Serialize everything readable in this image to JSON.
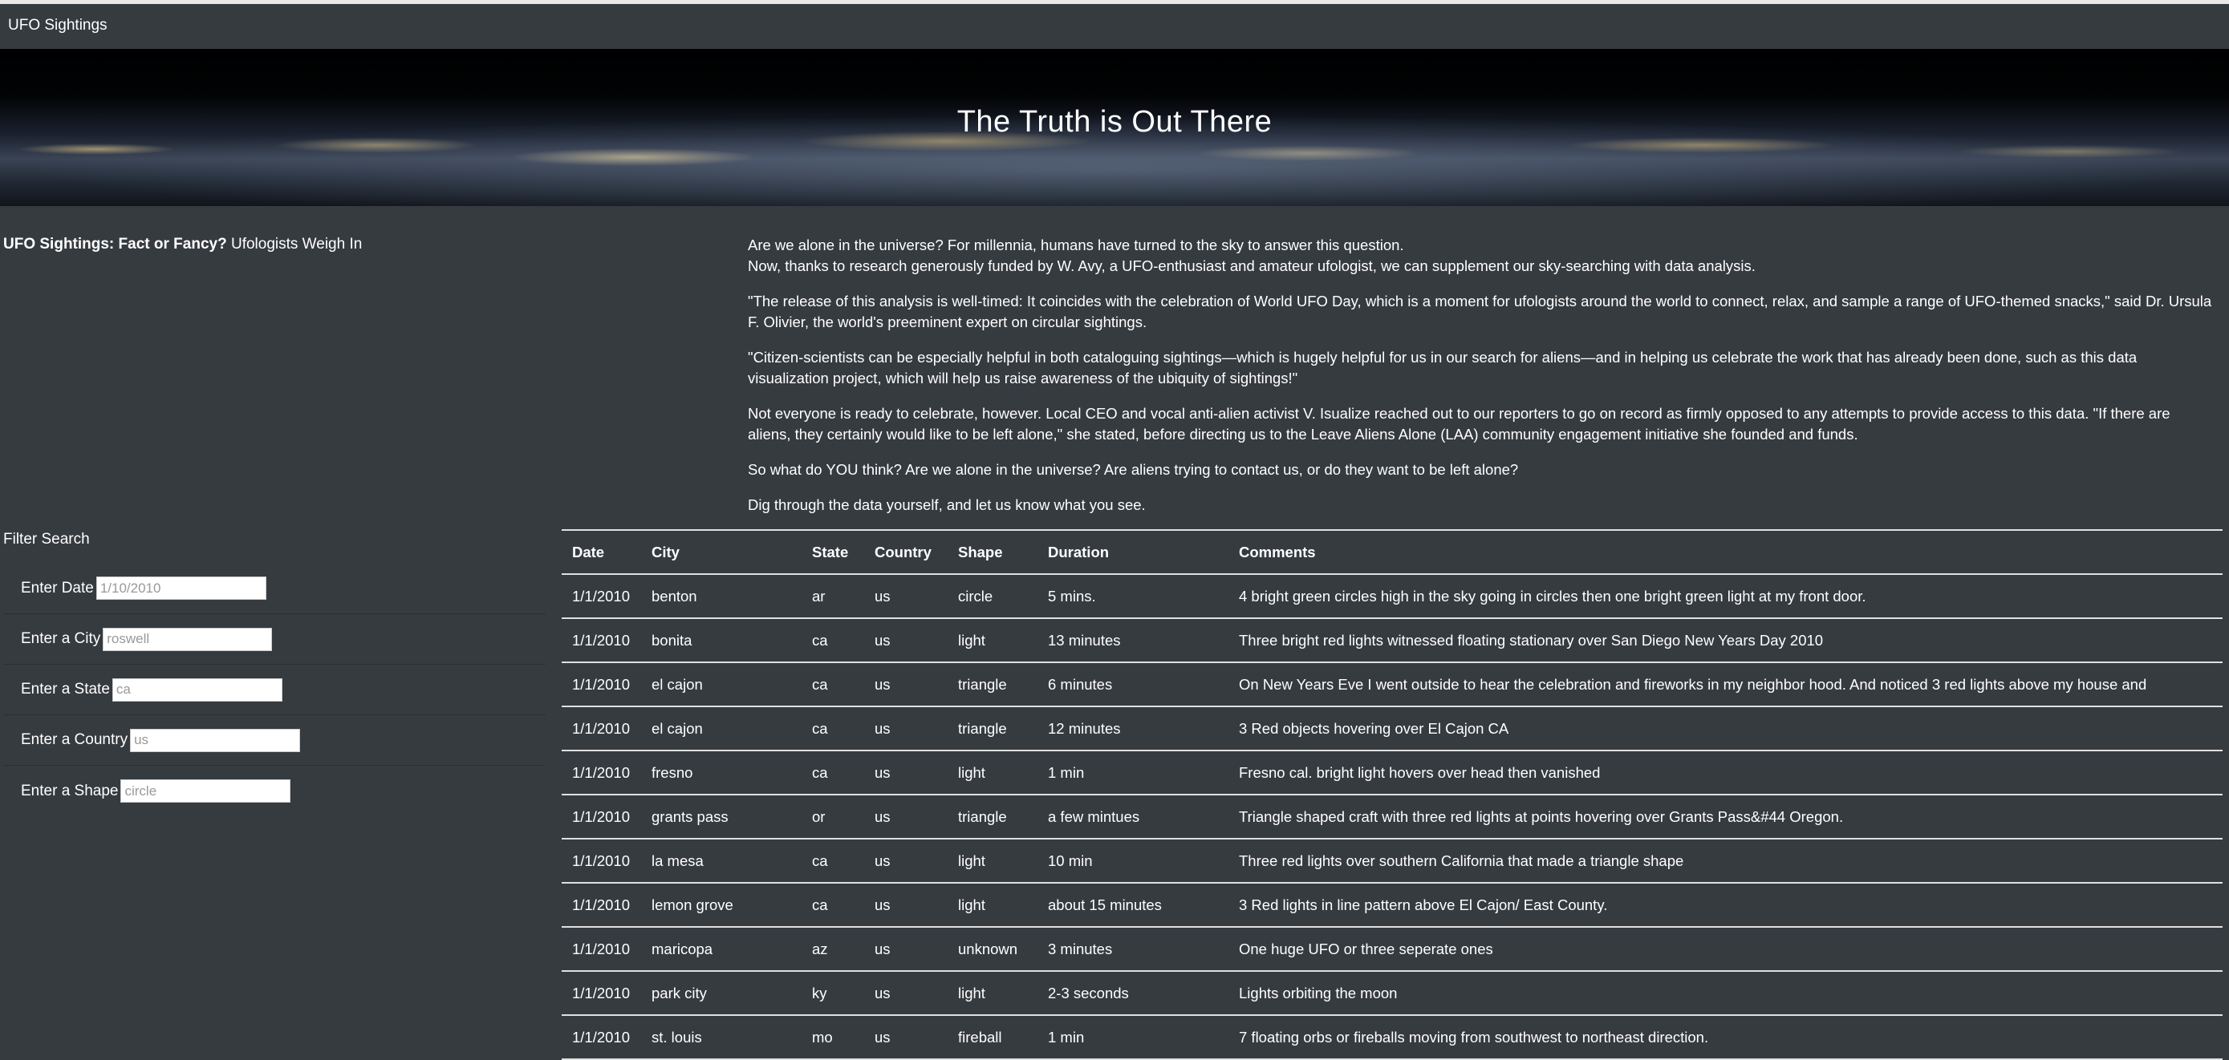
{
  "navbar": {
    "brand": "UFO Sightings"
  },
  "hero": {
    "title": "The Truth is Out There"
  },
  "article": {
    "heading_bold": "UFO Sightings: Fact or Fancy?",
    "heading_rest": " Ufologists Weigh In",
    "p1_line1": "Are we alone in the universe? For millennia, humans have turned to the sky to answer this question.",
    "p1_line2": "Now, thanks to research generously funded by W. Avy, a UFO-enthusiast and amateur ufologist, we can supplement our sky-searching with data analysis.",
    "p2": "\"The release of this analysis is well-timed: It coincides with the celebration of World UFO Day, which is a moment for ufologists around the world to connect, relax, and sample a range of UFO-themed snacks,\" said Dr. Ursula F. Olivier, the world's preeminent expert on circular sightings.",
    "p3": "\"Citizen-scientists can be especially helpful in both cataloguing sightings—which is hugely helpful for us in our search for aliens—and in helping us celebrate the work that has already been done, such as this data visualization project, which will help us raise awareness of the ubiquity of sightings!\"",
    "p4": "Not everyone is ready to celebrate, however. Local CEO and vocal anti-alien activist V. Isualize reached out to our reporters to go on record as firmly opposed to any attempts to provide access to this data. \"If there are aliens, they certainly would like to be left alone,\" she stated, before directing us to the Leave Aliens Alone (LAA) community engagement initiative she founded and funds.",
    "p5": "So what do YOU think? Are we alone in the universe? Are aliens trying to contact us, or do they want to be left alone?",
    "p6": "Dig through the data yourself, and let us know what you see."
  },
  "filters": {
    "title": "Filter Search",
    "date": {
      "label": "Enter Date",
      "placeholder": "1/10/2010"
    },
    "city": {
      "label": "Enter a City",
      "placeholder": "roswell"
    },
    "state": {
      "label": "Enter a State",
      "placeholder": "ca"
    },
    "country": {
      "label": "Enter a Country",
      "placeholder": "us"
    },
    "shape": {
      "label": "Enter a Shape",
      "placeholder": "circle"
    }
  },
  "table": {
    "headers": [
      "Date",
      "City",
      "State",
      "Country",
      "Shape",
      "Duration",
      "Comments"
    ],
    "rows": [
      [
        "1/1/2010",
        "benton",
        "ar",
        "us",
        "circle",
        "5 mins.",
        "4 bright green circles high in the sky going in circles then one bright green light at my front door."
      ],
      [
        "1/1/2010",
        "bonita",
        "ca",
        "us",
        "light",
        "13 minutes",
        "Three bright red lights witnessed floating stationary over San Diego New Years Day 2010"
      ],
      [
        "1/1/2010",
        "el cajon",
        "ca",
        "us",
        "triangle",
        "6 minutes",
        "On New Years Eve I went outside to hear the celebration and fireworks in my neighbor hood. And noticed 3 red lights above my house and"
      ],
      [
        "1/1/2010",
        "el cajon",
        "ca",
        "us",
        "triangle",
        "12 minutes",
        "3 Red objects hovering over El Cajon CA"
      ],
      [
        "1/1/2010",
        "fresno",
        "ca",
        "us",
        "light",
        "1 min",
        "Fresno cal. bright light hovers over head then vanished"
      ],
      [
        "1/1/2010",
        "grants pass",
        "or",
        "us",
        "triangle",
        "a few mintues",
        "Triangle shaped craft with three red lights at points hovering over Grants Pass&#44 Oregon."
      ],
      [
        "1/1/2010",
        "la mesa",
        "ca",
        "us",
        "light",
        "10 min",
        "Three red lights over southern California that made a triangle shape"
      ],
      [
        "1/1/2010",
        "lemon grove",
        "ca",
        "us",
        "light",
        "about 15 minutes",
        "3 Red lights in line pattern above El Cajon/ East County."
      ],
      [
        "1/1/2010",
        "maricopa",
        "az",
        "us",
        "unknown",
        "3 minutes",
        "One huge UFO or three seperate ones"
      ],
      [
        "1/1/2010",
        "park city",
        "ky",
        "us",
        "light",
        "2-3 seconds",
        "Lights orbiting the moon"
      ],
      [
        "1/1/2010",
        "st. louis",
        "mo",
        "us",
        "fireball",
        "1 min",
        "7 floating orbs or fireballs moving from southwest to northeast direction."
      ]
    ]
  }
}
